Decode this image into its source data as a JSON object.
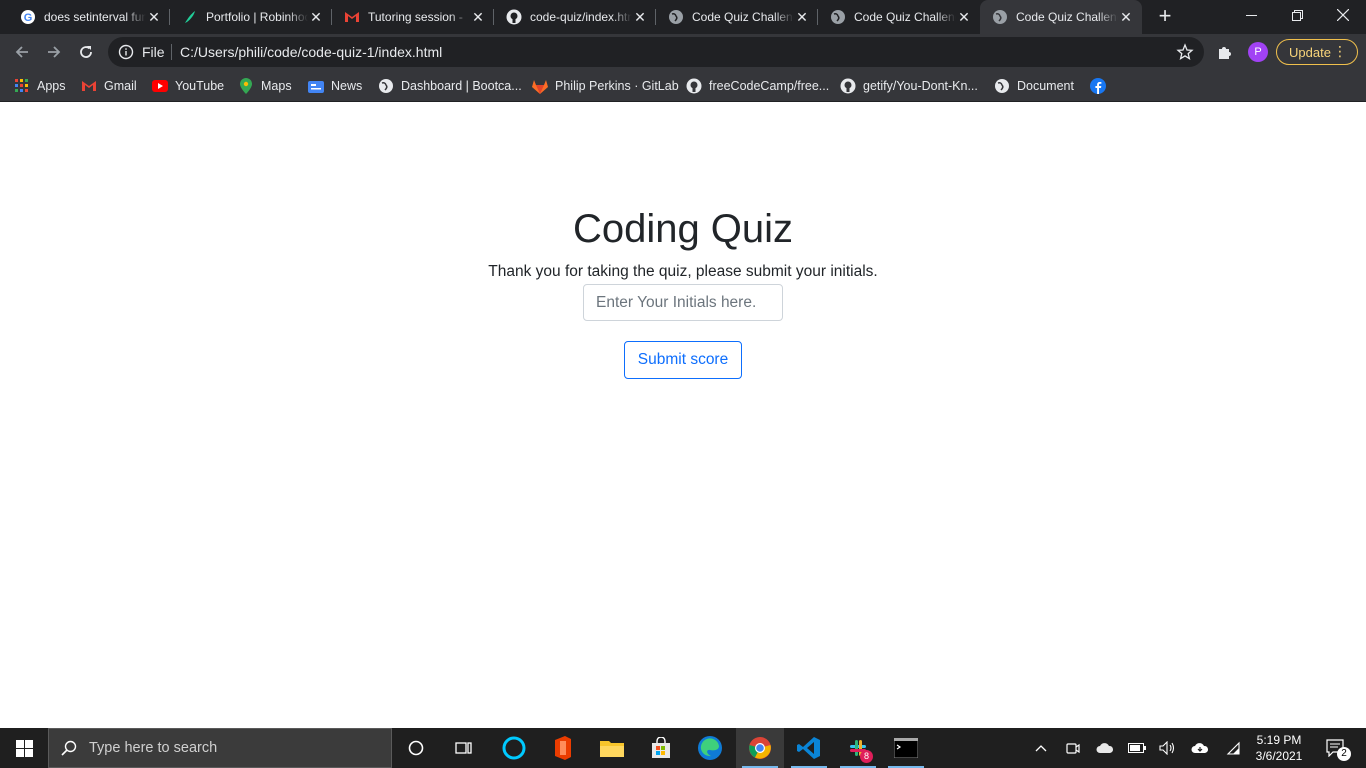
{
  "browser": {
    "tabs": [
      {
        "title": "does setinterval function",
        "favicon": "google-icon"
      },
      {
        "title": "Portfolio | Robinhood",
        "favicon": "robinhood-feather-icon"
      },
      {
        "title": "Tutoring session -",
        "favicon": "gmail-icon"
      },
      {
        "title": "code-quiz/index.html",
        "favicon": "github-icon"
      },
      {
        "title": "Code Quiz Challenge",
        "favicon": "globe-icon"
      },
      {
        "title": "Code Quiz Challenge",
        "favicon": "globe-icon"
      },
      {
        "title": "Code Quiz Challenge",
        "favicon": "globe-icon"
      }
    ],
    "omnibox": {
      "scheme_label": "File",
      "url": "C:/Users/phili/code/code-quiz-1/index.html"
    },
    "profile_initial": "P",
    "update_label": "Update",
    "bookmarks": [
      {
        "label": "Apps",
        "icon": "apps-grid-icon"
      },
      {
        "label": "Gmail",
        "icon": "gmail-icon"
      },
      {
        "label": "YouTube",
        "icon": "youtube-icon"
      },
      {
        "label": "Maps",
        "icon": "maps-pin-icon"
      },
      {
        "label": "News",
        "icon": "news-icon"
      },
      {
        "label": "Dashboard | Bootca...",
        "icon": "globe-icon"
      },
      {
        "label": "Philip Perkins · GitLab",
        "icon": "gitlab-icon"
      },
      {
        "label": "freeCodeCamp/free...",
        "icon": "github-icon"
      },
      {
        "label": "getify/You-Dont-Kn...",
        "icon": "github-icon"
      },
      {
        "label": "Document",
        "icon": "globe-icon"
      },
      {
        "label": "",
        "icon": "facebook-icon"
      }
    ]
  },
  "page": {
    "title": "Coding Quiz",
    "message": "Thank you for taking the quiz, please submit your initials.",
    "initials_placeholder": "Enter Your Initials here.",
    "submit_label": "Submit score"
  },
  "taskbar": {
    "search_placeholder": "Type here to search",
    "slack_badge": "8",
    "time": "5:19 PM",
    "date": "3/6/2021",
    "notifications_count": "2"
  },
  "colors": {
    "accent_primary": "#0d6efd",
    "update_border": "#f0c04c",
    "profile": "#a142f4"
  }
}
